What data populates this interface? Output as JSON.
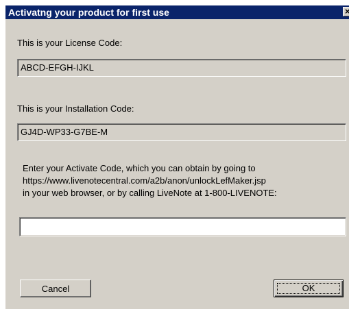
{
  "window": {
    "title": "Activatng your product for first use",
    "close_glyph": "×"
  },
  "license": {
    "label": "This is your License Code:",
    "value": "ABCD-EFGH-IJKL"
  },
  "installation": {
    "label": "This is your Installation Code:",
    "value": "GJ4D-WP33-G7BE-M"
  },
  "activation": {
    "instructions": [
      "Enter your Activate Code, which you can obtain by going to",
      "https://www.livenotecentral.com/a2b/anon/unlockLefMaker.jsp",
      "in your web browser, or by calling LiveNote at 1-800-LIVENOTE:"
    ],
    "input_value": ""
  },
  "buttons": {
    "cancel_label": "Cancel",
    "ok_label": "OK"
  },
  "colors": {
    "titlebar": "#0a246a",
    "dialog_face": "#d4d0c8"
  }
}
